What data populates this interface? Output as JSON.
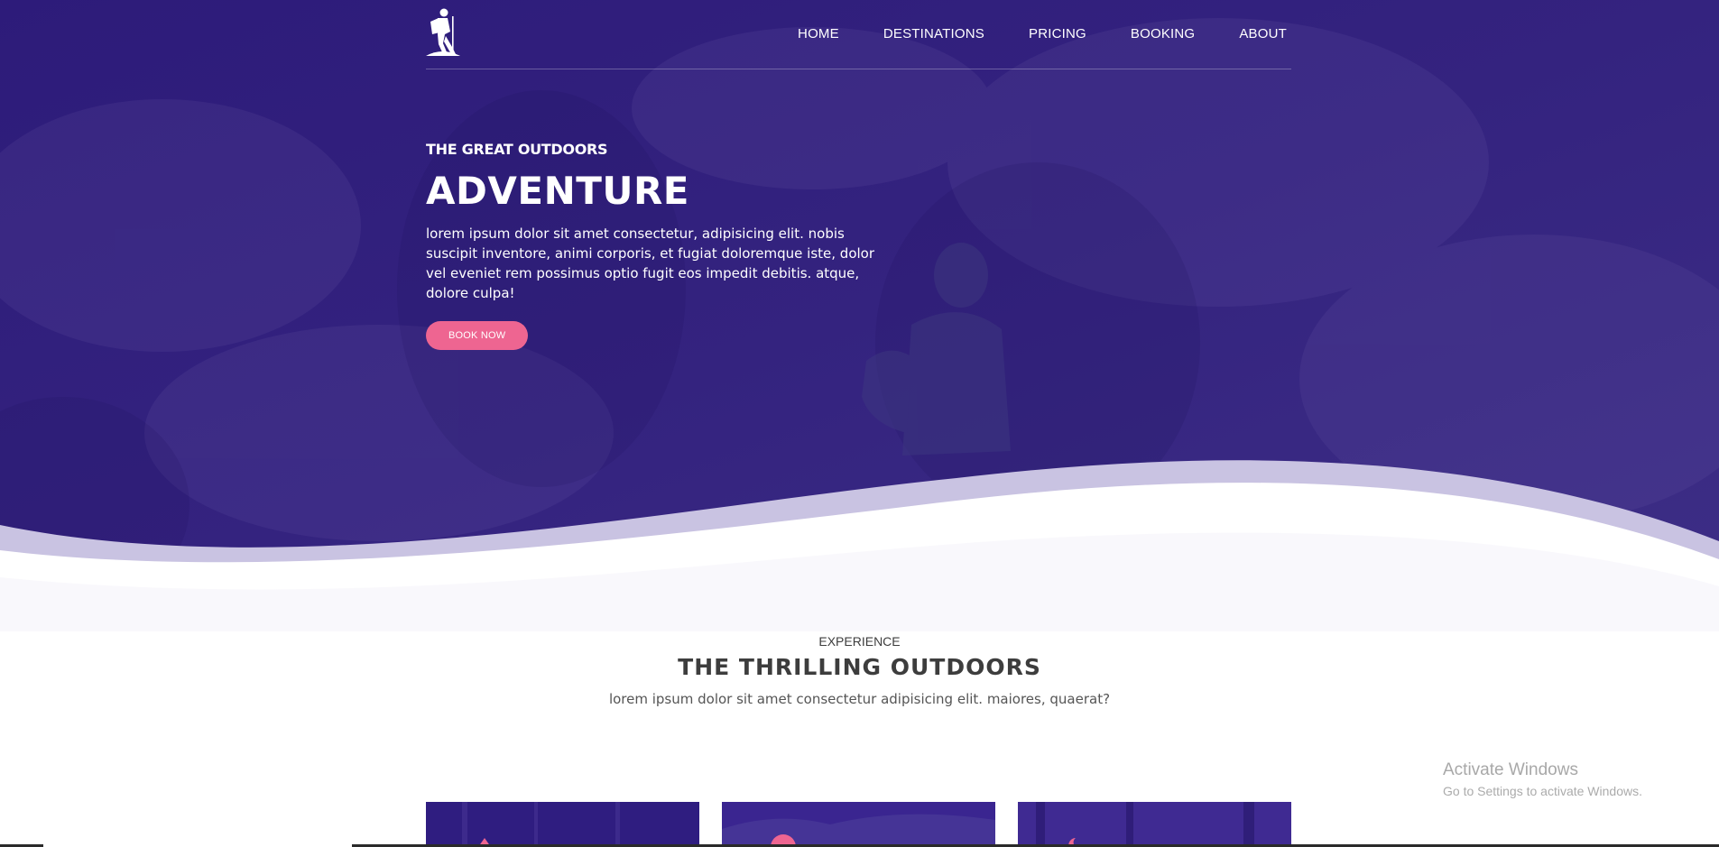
{
  "nav": {
    "links": [
      "HOME",
      "DESTINATIONS",
      "PRICING",
      "BOOKING",
      "ABOUT"
    ]
  },
  "hero": {
    "eyebrow": "THE GREAT OUTDOORS",
    "title": "ADVENTURE",
    "text": "lorem ipsum dolor sit amet consectetur, adipisicing elit. nobis suscipit inventore, animi corporis, et fugiat doloremque iste, dolor vel eveniet rem possimus optio fugit eos impedit debitis. atque, dolore culpa!",
    "button_label": "BOOK NOW"
  },
  "section": {
    "eyebrow": "EXPERIENCE",
    "title": "THE THRILLING OUTDOORS",
    "text": "lorem ipsum dolor sit amet consectetur adipisicing elit. maiores, quaerat?"
  },
  "watermark": {
    "title": "Activate Windows",
    "subtitle": "Go to Settings to activate Windows."
  },
  "icons": {
    "logo": "hiker-logo-icon",
    "card1": "tent-icon",
    "card2": "sun-icon",
    "card3": "moon-icon"
  },
  "colors": {
    "hero_overlay": "#2b1a78",
    "accent_pink": "#ee6591",
    "wave_light": "#c9c3e2",
    "card_purple": "#3a2590"
  }
}
